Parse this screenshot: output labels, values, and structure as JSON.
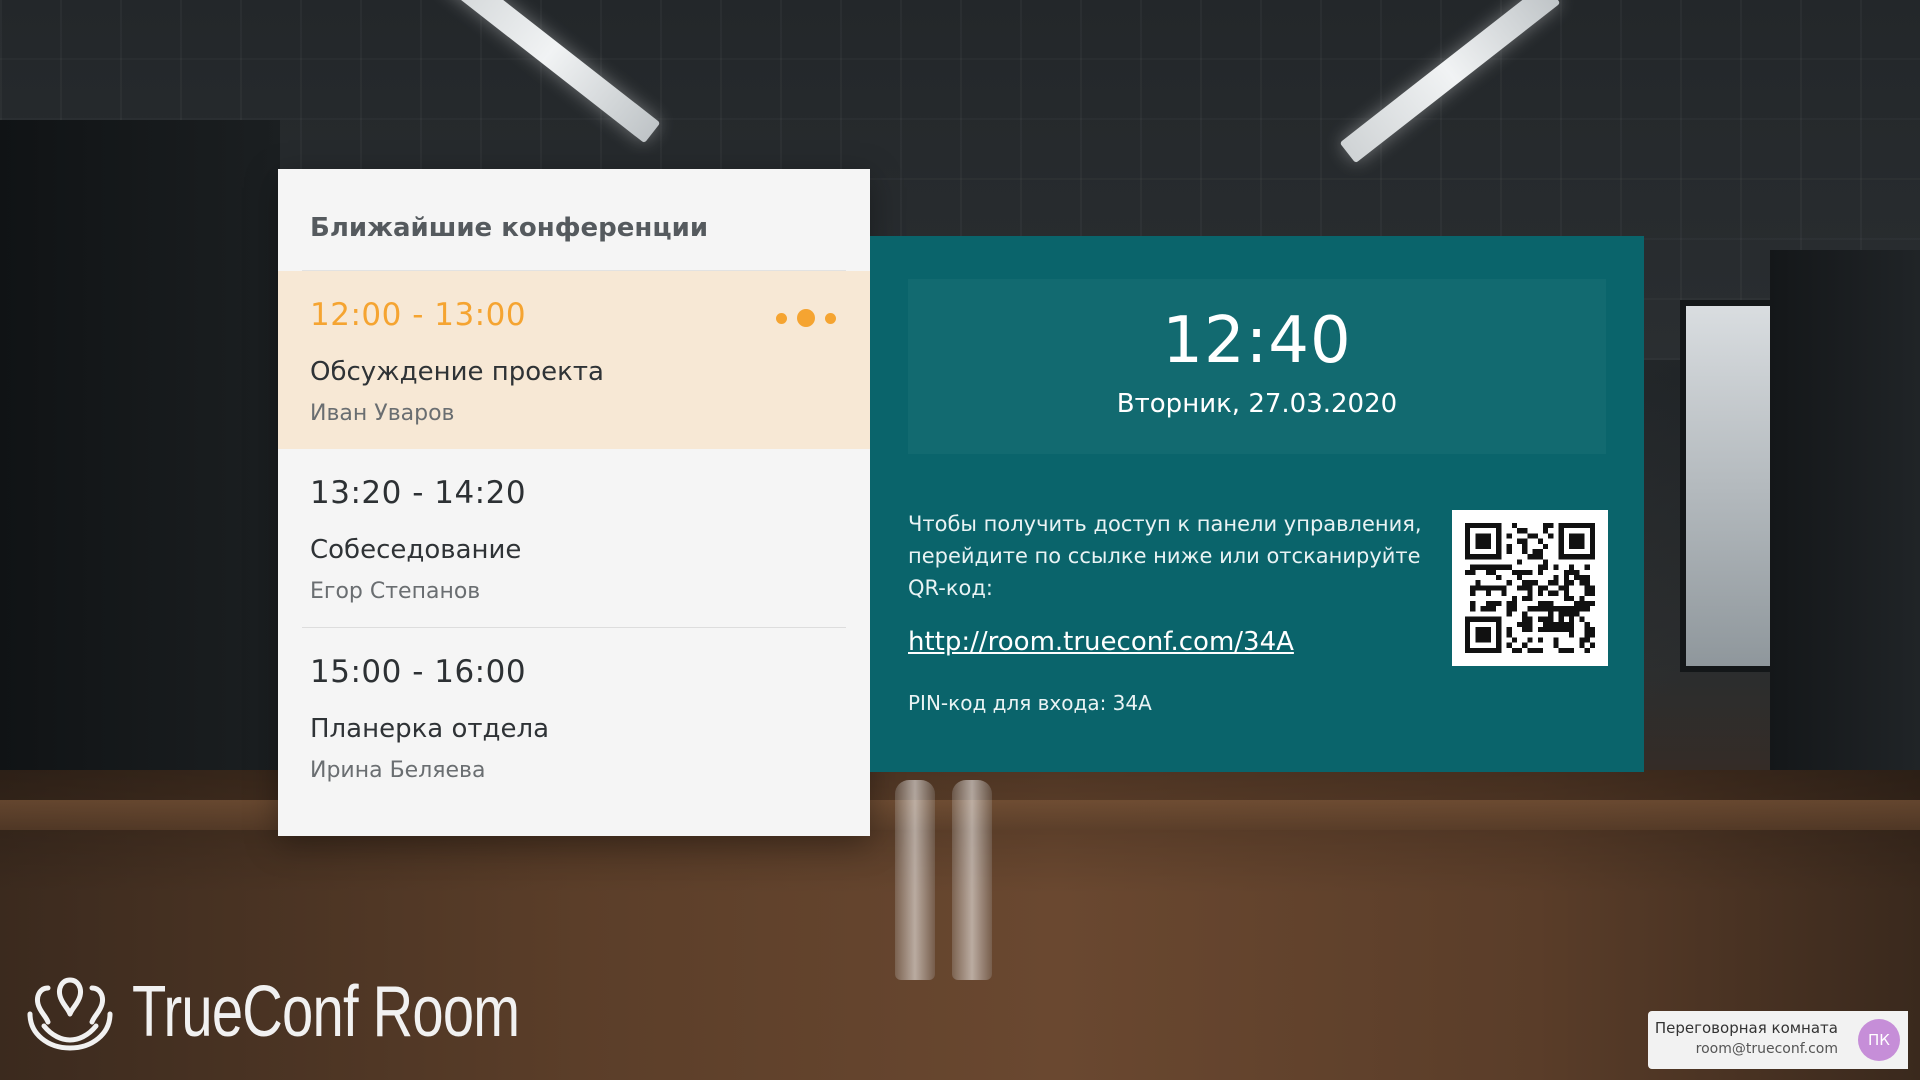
{
  "conferences": {
    "title": "Ближайшие конференции",
    "items": [
      {
        "time": "12:00 - 13:00",
        "title": "Обсуждение проекта",
        "person": "Иван Уваров",
        "active": true
      },
      {
        "time": "13:20 - 14:20",
        "title": "Собеседование",
        "person": "Егор Степанов",
        "active": false
      },
      {
        "time": "15:00 - 16:00",
        "title": "Планерка отдела",
        "person": "Ирина Беляева",
        "active": false
      }
    ]
  },
  "clock": {
    "time": "12:40",
    "date": "Вторник, 27.03.2020"
  },
  "access": {
    "text": "Чтобы получить доступ к панели управления, перейдите по ссылке ниже или отсканируйте QR-код:",
    "link": "http://room.trueconf.com/34A",
    "pin": "PIN-код для входа: 34A"
  },
  "brand": {
    "name": "TrueConf Room"
  },
  "room": {
    "name": "Переговорная комната",
    "email": "room@trueconf.com",
    "avatar_initials": "ПК"
  },
  "colors": {
    "accent_orange": "#f5a431",
    "panel_teal": "#0a646b",
    "active_row": "#f7e8d5",
    "avatar": "#c68ed8"
  },
  "icons": {
    "status": "more-dots-icon",
    "qr": "qr-code-icon",
    "logo": "trueconf-logo-icon"
  }
}
